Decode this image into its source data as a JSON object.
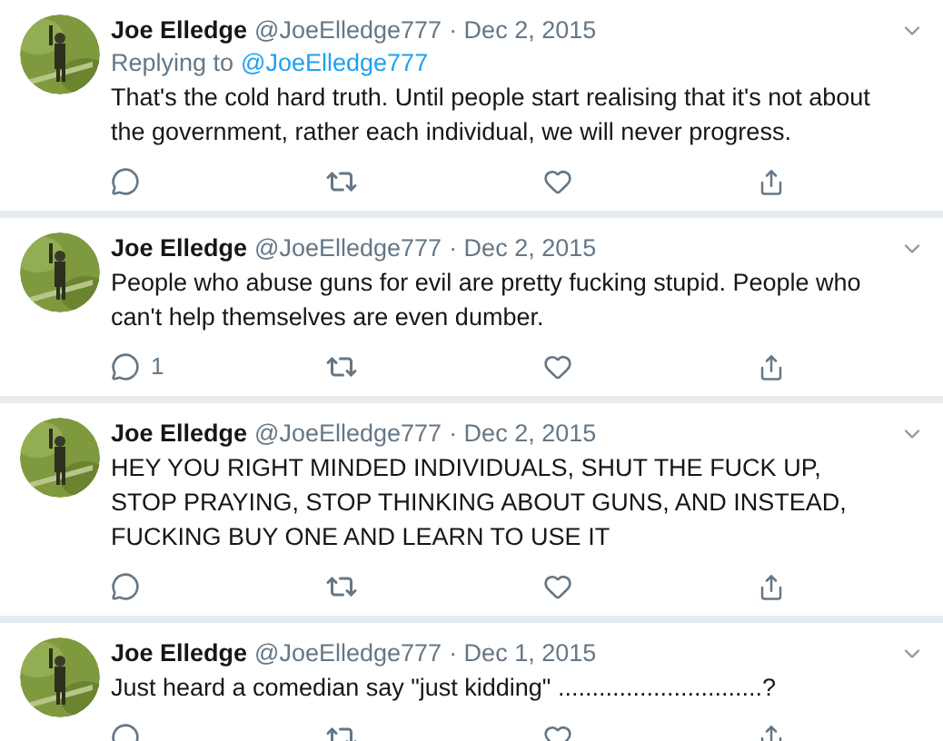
{
  "tweets": [
    {
      "name": "Joe Elledge",
      "handle": "@JoeElledge777",
      "date": "· Dec 2, 2015",
      "replying": {
        "label": "Replying to",
        "handle": "@JoeElledge777"
      },
      "text": "That's the cold hard truth. Until people start realising that it's not about the government, rather each individual, we will never progress."
    },
    {
      "name": "Joe Elledge",
      "handle": "@JoeElledge777",
      "date": "· Dec 2, 2015",
      "text": "People who abuse guns for evil are pretty fucking stupid. People who can't help themselves are even dumber.",
      "reply_count": "1"
    },
    {
      "name": "Joe Elledge",
      "handle": "@JoeElledge777",
      "date": "· Dec 2, 2015",
      "text": "HEY YOU RIGHT MINDED INDIVIDUALS, SHUT THE FUCK UP, STOP PRAYING, STOP THINKING ABOUT GUNS, AND INSTEAD, FUCKING BUY ONE AND LEARN TO USE IT"
    },
    {
      "name": "Joe Elledge",
      "handle": "@JoeElledge777",
      "date": "· Dec 1, 2015",
      "text": "Just heard a comedian say \"just kidding\" ..............................?"
    }
  ]
}
